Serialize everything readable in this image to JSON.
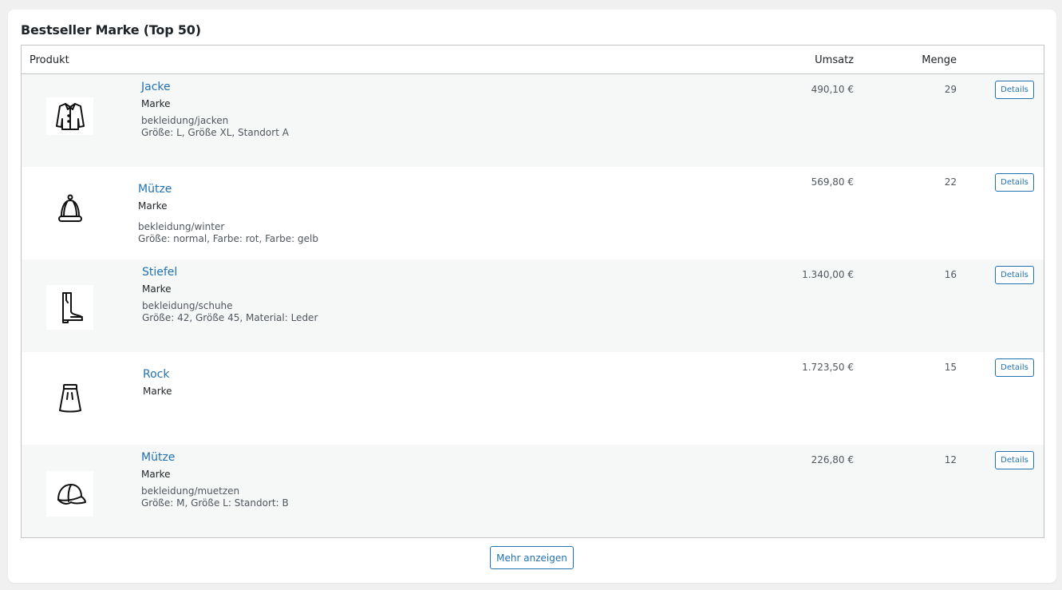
{
  "widget": {
    "title": "Bestseller Marke (Top 50)",
    "more_label": "Mehr anzeigen"
  },
  "table": {
    "columns": {
      "product": "Produkt",
      "revenue": "Umsatz",
      "quantity": "Menge"
    },
    "rows": [
      {
        "name": "Jacke",
        "brand": "Marke",
        "category": "bekleidung/jacken",
        "attributes": "Größe: L, Größe XL, Standort A",
        "revenue": "490,10 €",
        "quantity": "29",
        "action": "Details",
        "icon": "jacket-icon"
      },
      {
        "name": "Mütze",
        "brand": "Marke",
        "category": "bekleidung/winter",
        "attributes": "Größe: normal, Farbe: rot, Farbe: gelb",
        "revenue": "569,80 €",
        "quantity": "22",
        "action": "Details",
        "icon": "winter-hat-icon"
      },
      {
        "name": "Stiefel",
        "brand": "Marke",
        "category": "bekleidung/schuhe",
        "attributes": "Größe: 42, Größe 45, Material: Leder",
        "revenue": "1.340,00 €",
        "quantity": "16",
        "action": "Details",
        "icon": "boot-icon"
      },
      {
        "name": "Rock",
        "brand": "Marke",
        "category": "",
        "attributes": "",
        "revenue": "1.723,50 €",
        "quantity": "15",
        "action": "Details",
        "icon": "skirt-icon"
      },
      {
        "name": "Mütze",
        "brand": "Marke",
        "category": "bekleidung/muetzen",
        "attributes": "Größe: M, Größe L: Standort: B",
        "revenue": "226,80 €",
        "quantity": "12",
        "action": "Details",
        "icon": "cap-icon"
      }
    ]
  },
  "colors": {
    "accent": "#2271b1",
    "row_alt": "#f6f7f7",
    "border": "#c3c4c7"
  }
}
